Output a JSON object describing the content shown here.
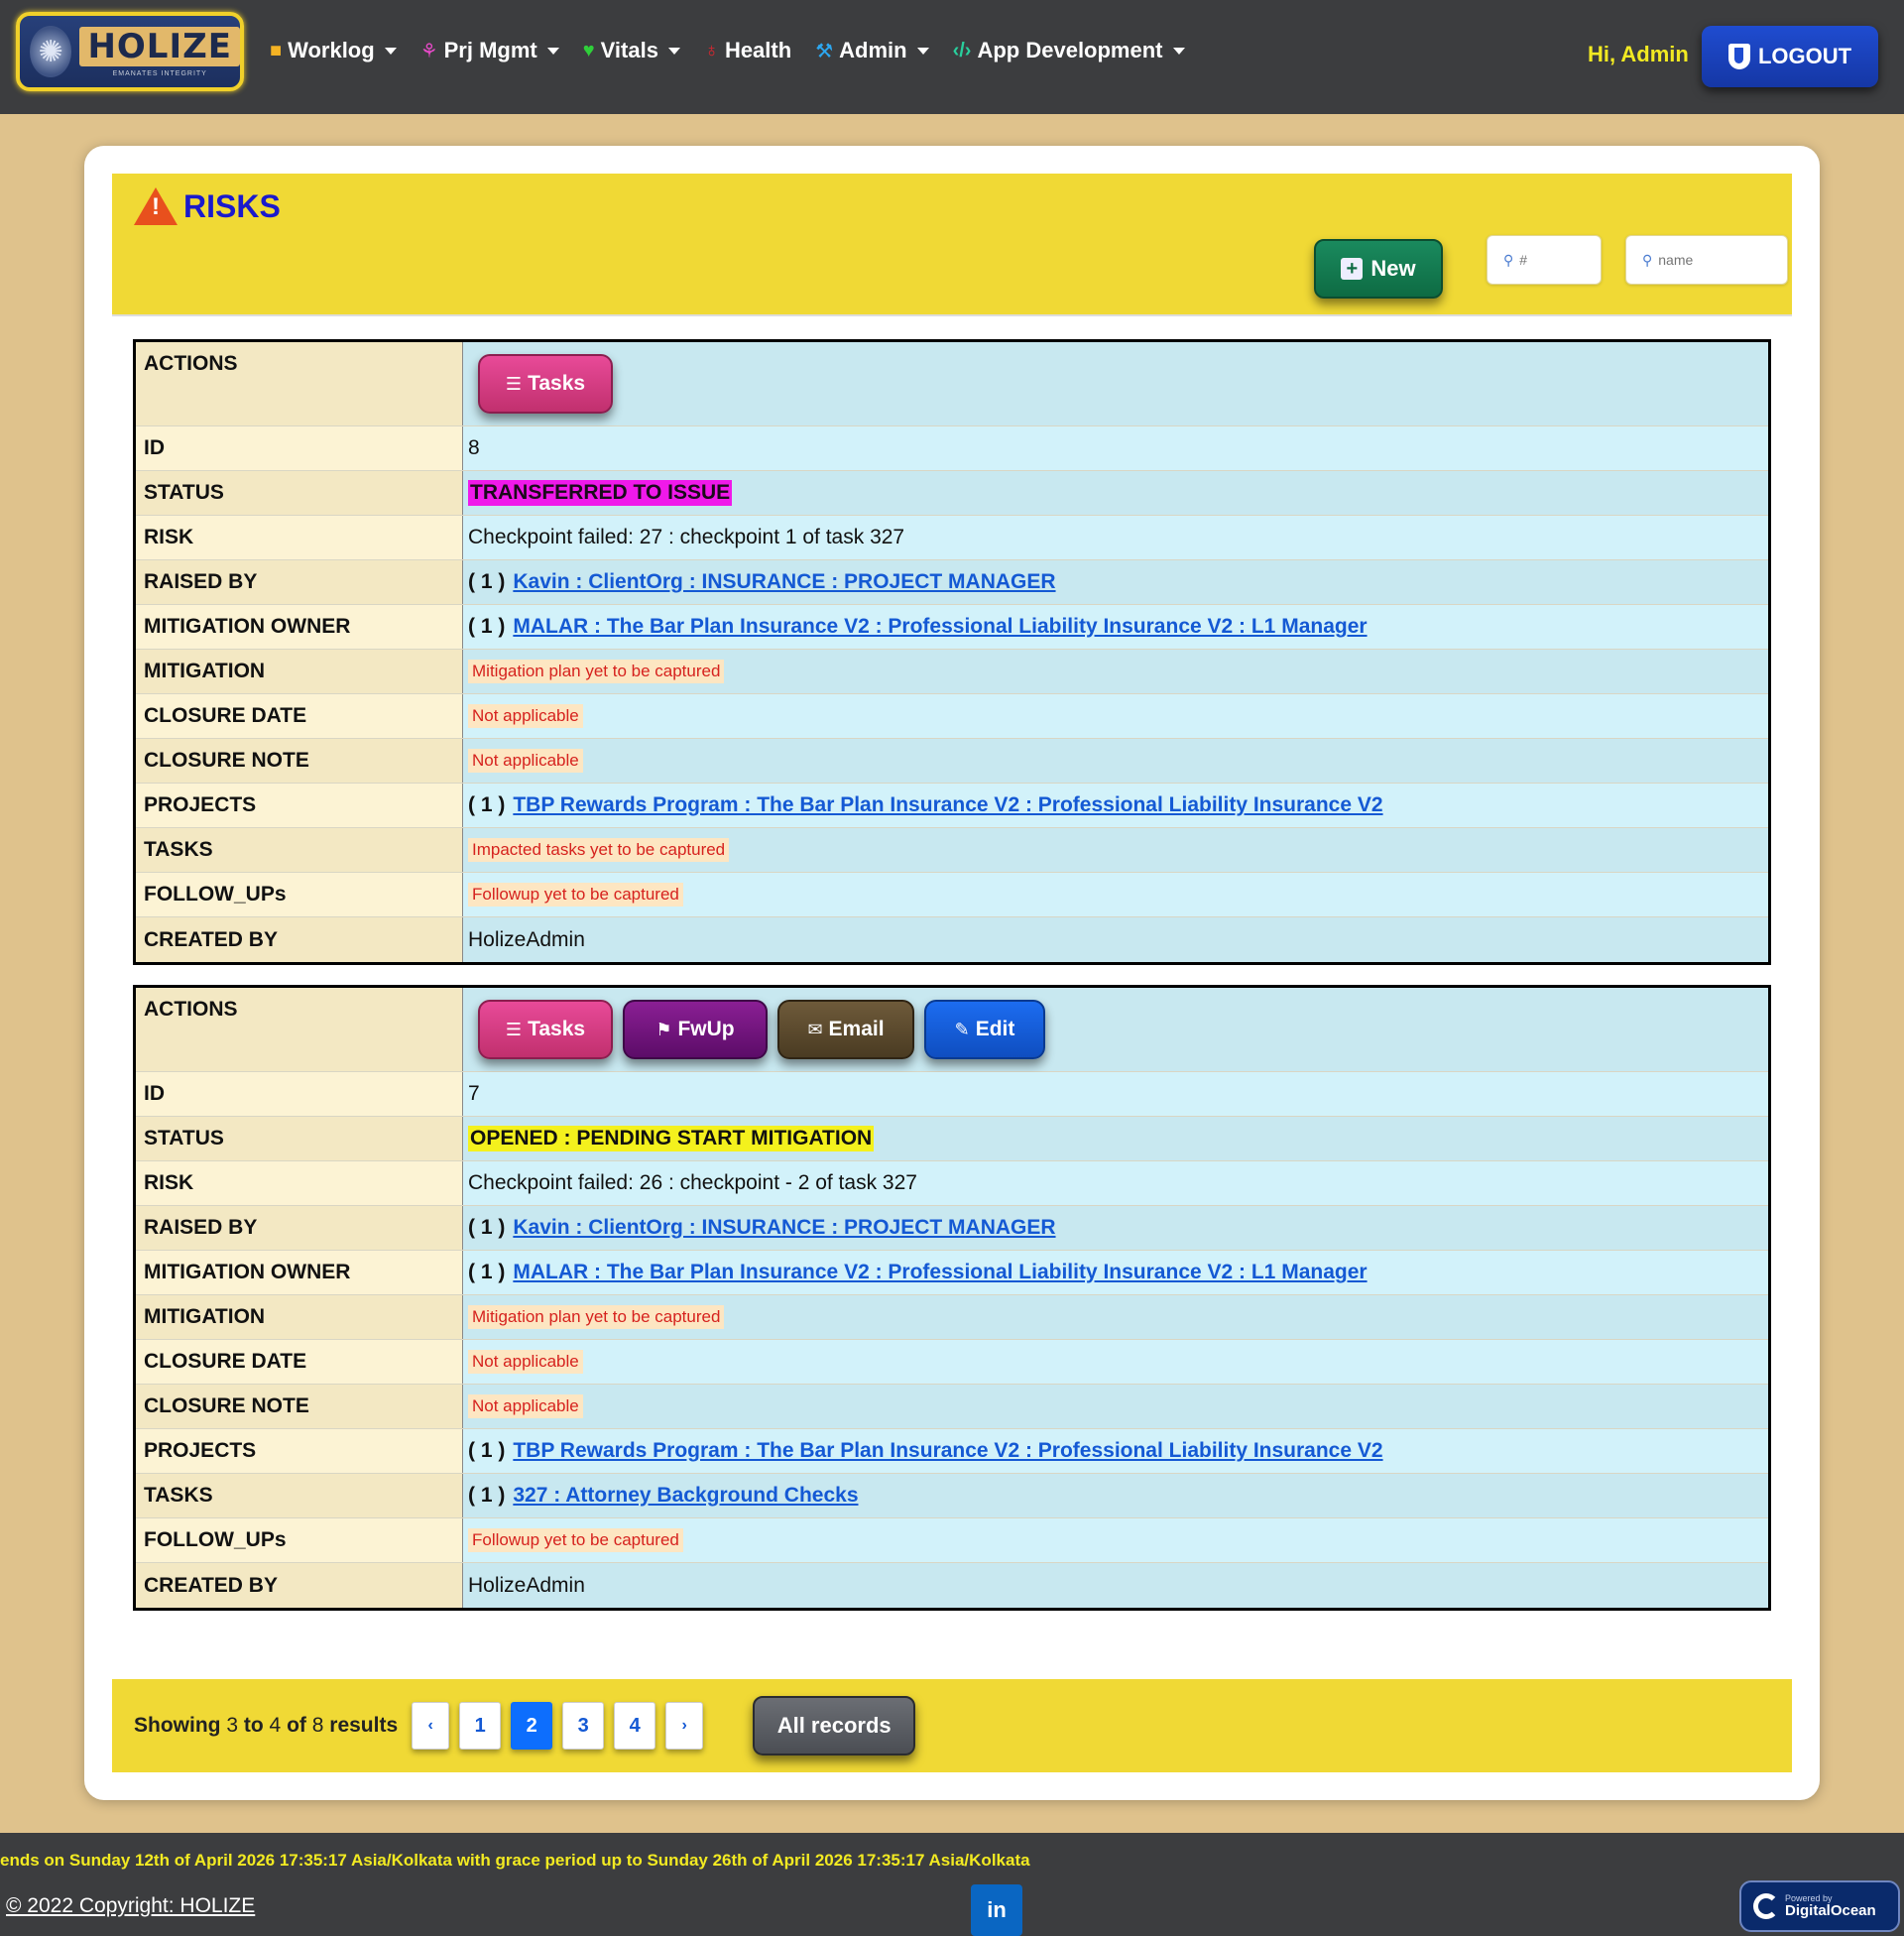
{
  "nav": {
    "logo_text": "HOLIZE",
    "logo_tagline": "EMANATES INTEGRITY",
    "items": [
      {
        "label": "Worklog",
        "icon": "briefcase-icon",
        "icon_color": "#f4b324",
        "dropdown": true
      },
      {
        "label": "Prj Mgmt",
        "icon": "project-tree-icon",
        "icon_color": "#e64ac7",
        "dropdown": true
      },
      {
        "label": "Vitals",
        "icon": "heart-icon",
        "icon_color": "#2fcf3a",
        "dropdown": true
      },
      {
        "label": "Health",
        "icon": "stethoscope-icon",
        "icon_color": "#e0262f",
        "dropdown": false
      },
      {
        "label": "Admin",
        "icon": "hammer-icon",
        "icon_color": "#2ca7f0",
        "dropdown": true
      },
      {
        "label": "App Development",
        "icon": "code-icon",
        "icon_color": "#29cf9d",
        "dropdown": true
      }
    ],
    "greeting": "Hi, Admin",
    "logout_label": "LOGOUT"
  },
  "header": {
    "title": "RISKS",
    "new_label": "New",
    "search_id_placeholder": "#",
    "search_name_placeholder": "name"
  },
  "labels": {
    "actions": "ACTIONS",
    "id": "ID",
    "status": "STATUS",
    "risk": "RISK",
    "raised_by": "RAISED BY",
    "mitigation_owner": "MITIGATION OWNER",
    "mitigation": "MITIGATION",
    "closure_date": "CLOSURE DATE",
    "closure_note": "CLOSURE NOTE",
    "projects": "PROJECTS",
    "tasks": "TASKS",
    "follow_ups": "FOLLOW_UPs",
    "created_by": "CREATED BY"
  },
  "buttons": {
    "tasks": "Tasks",
    "fwup": "FwUp",
    "email": "Email",
    "edit": "Edit"
  },
  "risks": [
    {
      "id": "8",
      "status": "TRANSFERRED TO ISSUE",
      "status_color": "#f019ea",
      "risk": "Checkpoint failed: 27 : checkpoint 1 of task 327",
      "raised_by_count": "( 1 )",
      "raised_by": "Kavin : ClientOrg : INSURANCE : PROJECT MANAGER",
      "mitigation_owner_count": "( 1 )",
      "mitigation_owner": "MALAR : The Bar Plan Insurance V2 : Professional Liability Insurance V2 : L1 Manager",
      "mitigation": "Mitigation plan yet to be captured",
      "closure_date": "Not applicable",
      "closure_note": "Not applicable",
      "projects_count": "( 1 )",
      "projects": "TBP Rewards Program : The Bar Plan Insurance V2 : Professional Liability Insurance V2",
      "tasks": "Impacted tasks yet to be captured",
      "follow_ups": "Followup yet to be captured",
      "created_by": "HolizeAdmin"
    },
    {
      "id": "7",
      "status": "OPENED : PENDING START MITIGATION",
      "status_color": "#f4f11d",
      "risk": "Checkpoint failed: 26 : checkpoint - 2 of task 327",
      "raised_by_count": "( 1 )",
      "raised_by": "Kavin : ClientOrg : INSURANCE : PROJECT MANAGER",
      "mitigation_owner_count": "( 1 )",
      "mitigation_owner": "MALAR : The Bar Plan Insurance V2 : Professional Liability Insurance V2 : L1 Manager",
      "mitigation": "Mitigation plan yet to be captured",
      "closure_date": "Not applicable",
      "closure_note": "Not applicable",
      "projects_count": "( 1 )",
      "projects": "TBP Rewards Program : The Bar Plan Insurance V2 : Professional Liability Insurance V2",
      "tasks_count": "( 1 )",
      "tasks": "327 : Attorney Background Checks",
      "follow_ups": "Followup yet to be captured",
      "created_by": "HolizeAdmin"
    }
  ],
  "pagination": {
    "showing_prefix": "Showing",
    "from": "3",
    "to_word": "to",
    "to": "4",
    "of_word": "of",
    "total": "8",
    "results_word": "results",
    "prev": "‹",
    "pages": [
      "1",
      "2",
      "3",
      "4"
    ],
    "active_page": "2",
    "next": "›",
    "all_records_label": "All records"
  },
  "footer": {
    "license_note": "ends on Sunday 12th of April 2026 17:35:17 Asia/Kolkata with grace period up to Sunday 26th of April 2026 17:35:17 Asia/Kolkata",
    "copyright": "© 2022 Copyright: HOLIZE",
    "linkedin": "in",
    "do_small": "Powered by",
    "do_big": "DigitalOcean"
  }
}
